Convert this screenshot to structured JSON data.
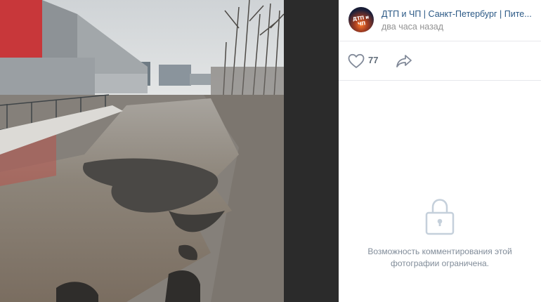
{
  "post": {
    "group_name": "ДТП и ЧП | Санкт-Петербург | Пите...",
    "avatar_text": "ДТП и ЧП",
    "time": "два часа назад"
  },
  "actions": {
    "likes": "77"
  },
  "comments": {
    "restricted_line1": "Возможность комментирования этой",
    "restricted_line2": "фотографии ограничена."
  },
  "colors": {
    "link": "#2a5885",
    "muted": "#939393",
    "backdrop": "#2b2b2b"
  },
  "icons": [
    "heart-icon",
    "share-arrow-icon",
    "lock-icon"
  ]
}
